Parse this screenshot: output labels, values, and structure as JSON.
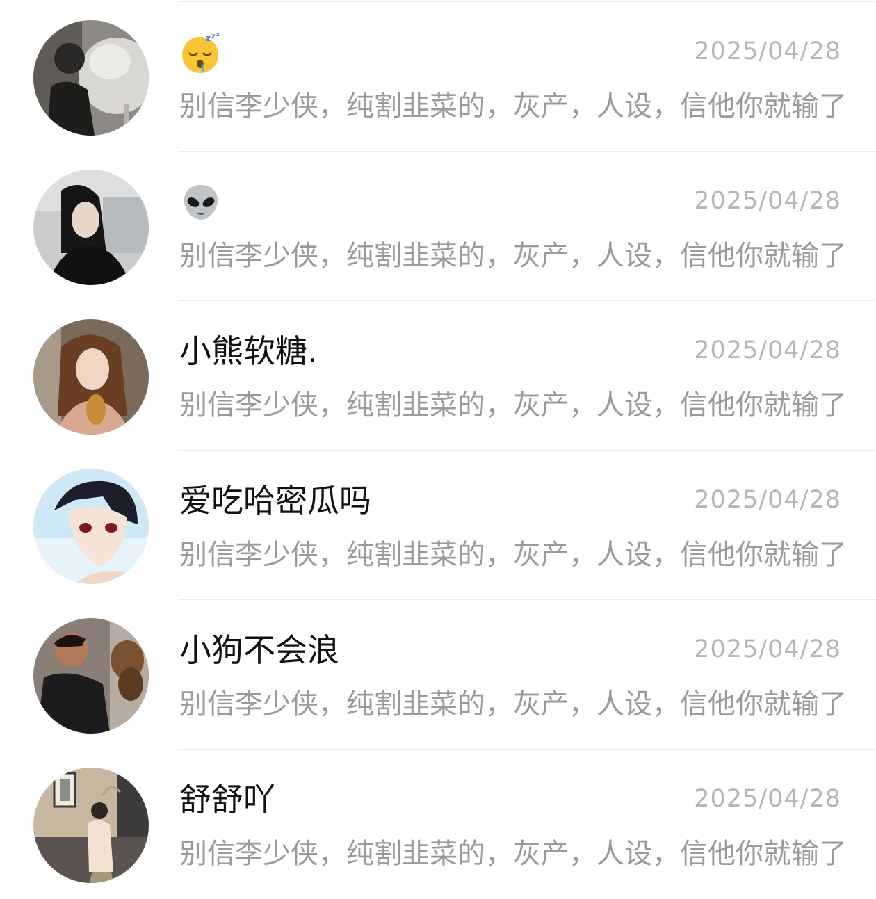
{
  "conversations": [
    {
      "name": "",
      "name_icon": "sleeping-face-emoji",
      "date": "2025/04/28",
      "preview": "别信李少侠，纯割韭菜的，灰产，人设，信他你就输了"
    },
    {
      "name": "",
      "name_icon": "alien-emoji",
      "date": "2025/04/28",
      "preview": "别信李少侠，纯割韭菜的，灰产，人设，信他你就输了"
    },
    {
      "name": "小熊软糖.",
      "date": "2025/04/28",
      "preview": "别信李少侠，纯割韭菜的，灰产，人设，信他你就输了"
    },
    {
      "name": "爱吃哈密瓜吗",
      "date": "2025/04/28",
      "preview": "别信李少侠，纯割韭菜的，灰产，人设，信他你就输了"
    },
    {
      "name": "小狗不会浪",
      "date": "2025/04/28",
      "preview": "别信李少侠，纯割韭菜的，灰产，人设，信他你就输了"
    },
    {
      "name": "舒舒吖",
      "date": "2025/04/28",
      "preview": "别信李少侠，纯割韭菜的，灰产，人设，信他你就输了"
    }
  ],
  "colors": {
    "name_text": "#111111",
    "date_text": "#b5b5b5",
    "preview_text": "#9a9a9a",
    "divider": "#ececec",
    "background": "#ffffff"
  }
}
